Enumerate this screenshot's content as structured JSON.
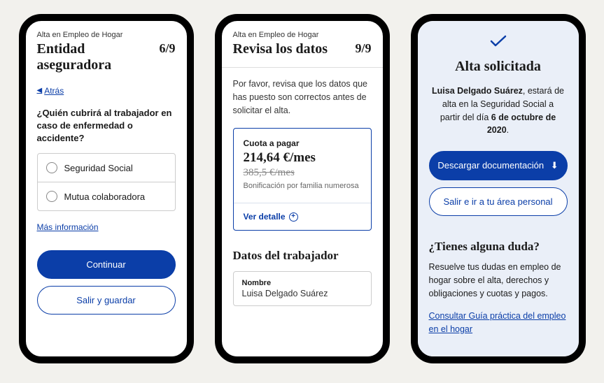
{
  "screen1": {
    "eyebrow": "Alta en Empleo de Hogar",
    "title": "Entidad aseguradora",
    "step": "6/9",
    "back": "Atrás",
    "question": "¿Quién cubrirá al trabajador en caso de enfermedad o accidente?",
    "options": [
      "Seguridad Social",
      "Mutua colaboradora"
    ],
    "more": "Más información",
    "continue": "Continuar",
    "exit": "Salir y guardar"
  },
  "screen2": {
    "eyebrow": "Alta en Empleo de Hogar",
    "title": "Revisa los datos",
    "step": "9/9",
    "intro": "Por favor, revisa que los datos que has puesto son correctos antes de solicitar el alta.",
    "quota": {
      "label": "Cuota a pagar",
      "amount": "214,64 €/mes",
      "old": "385,5 €/mes",
      "note": "Bonificación por familia numerosa",
      "detail": "Ver detalle"
    },
    "sectionTitle": "Datos del trabajador",
    "field": {
      "label": "Nombre",
      "value": "Luisa Delgado Suárez"
    }
  },
  "screen3": {
    "title": "Alta solicitada",
    "name": "Luisa Delgado Suárez",
    "text1": ", estará de alta en la Seguridad Social a partir del día ",
    "date": "6 de octubre de 2020",
    "download": "Descargar documentación",
    "exit": "Salir e ir a tu área personal",
    "faqTitle": "¿Tienes alguna duda?",
    "faqText": "Resuelve tus dudas en empleo de hogar sobre el alta, derechos y obligaciones y cuotas y pagos.",
    "faqLink": "Consultar Guía práctica del empleo en el hogar"
  }
}
